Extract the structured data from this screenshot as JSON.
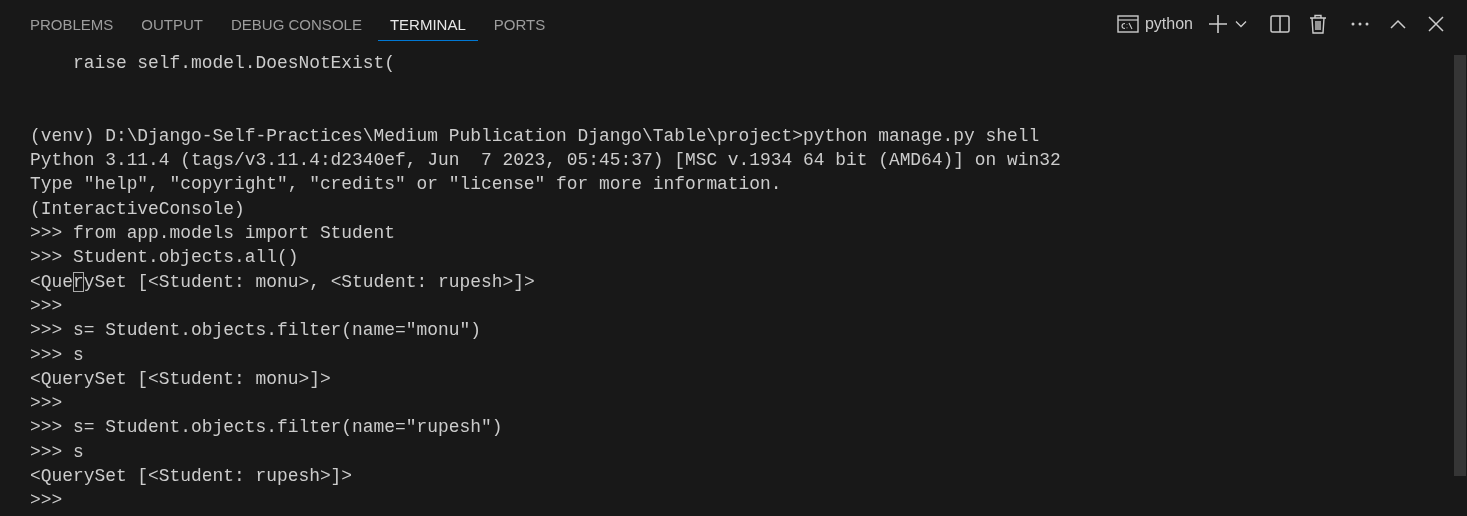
{
  "tabs": [
    {
      "label": "PROBLEMS",
      "selected": false
    },
    {
      "label": "OUTPUT",
      "selected": false
    },
    {
      "label": "DEBUG CONSOLE",
      "selected": false
    },
    {
      "label": "TERMINAL",
      "selected": true
    },
    {
      "label": "PORTS",
      "selected": false
    }
  ],
  "toolbar": {
    "terminal_name": "python"
  },
  "terminal": {
    "lines": [
      {
        "kind": "text",
        "text": "    raise self.model.DoesNotExist("
      },
      {
        "kind": "blank"
      },
      {
        "kind": "blank"
      },
      {
        "kind": "text",
        "text": "(venv) D:\\Django-Self-Practices\\Medium Publication Django\\Table\\project>python manage.py shell"
      },
      {
        "kind": "text",
        "text": "Python 3.11.4 (tags/v3.11.4:d2340ef, Jun  7 2023, 05:45:37) [MSC v.1934 64 bit (AMD64)] on win32"
      },
      {
        "kind": "text",
        "text": "Type \"help\", \"copyright\", \"credits\" or \"license\" for more information."
      },
      {
        "kind": "text",
        "text": "(InteractiveConsole)"
      },
      {
        "kind": "text",
        "text": ">>> from app.models import Student"
      },
      {
        "kind": "text",
        "text": ">>> Student.objects.all()"
      },
      {
        "kind": "cursor",
        "before": "<Que",
        "at": "r",
        "after": "ySet [<Student: monu>, <Student: rupesh>]>"
      },
      {
        "kind": "text",
        "text": ">>>"
      },
      {
        "kind": "text",
        "text": ">>> s= Student.objects.filter(name=\"monu\")"
      },
      {
        "kind": "text",
        "text": ">>> s"
      },
      {
        "kind": "text",
        "text": "<QuerySet [<Student: monu>]>"
      },
      {
        "kind": "text",
        "text": ">>>"
      },
      {
        "kind": "text",
        "text": ">>> s= Student.objects.filter(name=\"rupesh\")"
      },
      {
        "kind": "text",
        "text": ">>> s"
      },
      {
        "kind": "text",
        "text": "<QuerySet [<Student: rupesh>]>"
      },
      {
        "kind": "text",
        "text": ">>>"
      }
    ]
  }
}
